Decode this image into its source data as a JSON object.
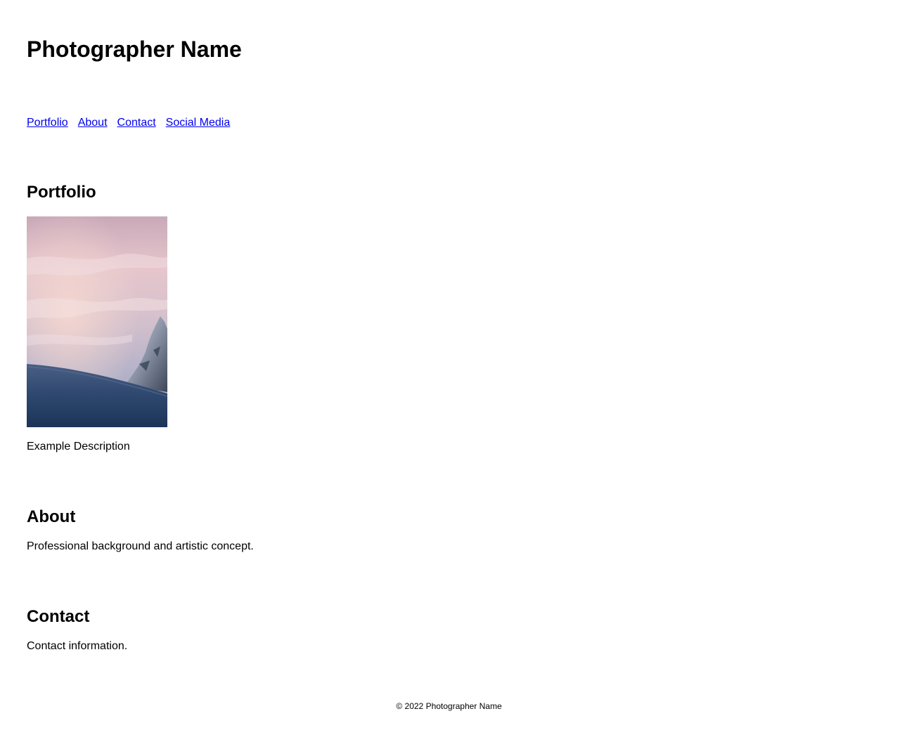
{
  "header": {
    "title": "Photographer Name"
  },
  "nav": {
    "links": [
      {
        "label": "Portfolio"
      },
      {
        "label": "About"
      },
      {
        "label": "Contact"
      },
      {
        "label": "Social Media"
      }
    ]
  },
  "portfolio": {
    "heading": "Portfolio",
    "items": [
      {
        "description": "Example Description"
      }
    ]
  },
  "about": {
    "heading": "About",
    "text": "Professional background and artistic concept."
  },
  "contact": {
    "heading": "Contact",
    "text": "Contact information."
  },
  "footer": {
    "text": "© 2022 Photographer Name"
  },
  "colors": {
    "link": "#0000ee",
    "text": "#000000",
    "background": "#ffffff"
  }
}
